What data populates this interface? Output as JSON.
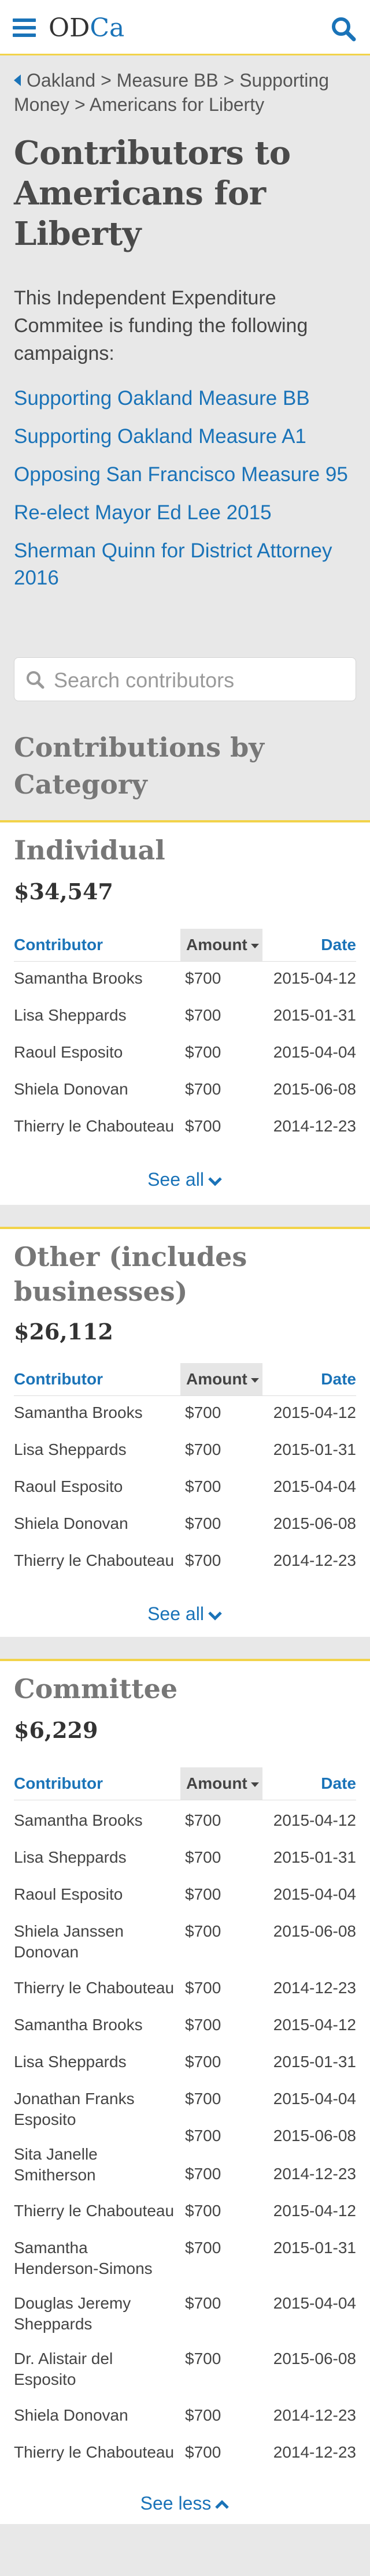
{
  "header": {
    "logo_od": "OD",
    "logo_ca": "Ca"
  },
  "breadcrumb": {
    "items": [
      "Oakland",
      "Measure BB",
      "Supporting Money",
      "Americans for Liberty"
    ],
    "separator": ">"
  },
  "page": {
    "title": "Contributors to Americans for Liberty",
    "intro": "This Independent Expenditure Commitee is funding the following campaigns:"
  },
  "campaigns": [
    "Supporting Oakland Measure BB",
    "Supporting Oakland Measure A1",
    "Opposing San Francisco Measure 95",
    "Re-elect Mayor Ed Lee 2015",
    "Sherman Quinn for District Attorney 2016"
  ],
  "search": {
    "placeholder": "Search contributors",
    "value": ""
  },
  "categories_heading": "Contributions by Category",
  "table_headers": {
    "contributor": "Contributor",
    "amount": "Amount",
    "date": "Date"
  },
  "sections": [
    {
      "title": "Individual",
      "total": "$34,547",
      "rows": [
        {
          "name": "Samantha Brooks",
          "amount": "$700",
          "date": "2015-04-12"
        },
        {
          "name": "Lisa Sheppards",
          "amount": "$700",
          "date": "2015-01-31"
        },
        {
          "name": "Raoul Esposito",
          "amount": "$700",
          "date": "2015-04-04"
        },
        {
          "name": "Shiela Donovan",
          "amount": "$700",
          "date": "2015-06-08"
        },
        {
          "name": "Thierry le Chabouteau",
          "amount": "$700",
          "date": "2014-12-23"
        }
      ],
      "toggle_label": "See all"
    },
    {
      "title": "Other (includes businesses)",
      "total": "$26,112",
      "rows": [
        {
          "name": "Samantha Brooks",
          "amount": "$700",
          "date": "2015-04-12"
        },
        {
          "name": "Lisa Sheppards",
          "amount": "$700",
          "date": "2015-01-31"
        },
        {
          "name": "Raoul Esposito",
          "amount": "$700",
          "date": "2015-04-04"
        },
        {
          "name": "Shiela Donovan",
          "amount": "$700",
          "date": "2015-06-08"
        },
        {
          "name": "Thierry le Chabouteau",
          "amount": "$700",
          "date": "2014-12-23"
        }
      ],
      "toggle_label": "See all"
    },
    {
      "title": "Committee",
      "total": "$6,229",
      "rows": [
        {
          "name": "Samantha Brooks",
          "amount": "$700",
          "date": "2015-04-12"
        },
        {
          "name": "Lisa Sheppards",
          "amount": "$700",
          "date": "2015-01-31"
        },
        {
          "name": "Raoul Esposito",
          "amount": "$700",
          "date": "2015-04-04"
        },
        {
          "name": "Shiela Janssen Donovan",
          "amount": "$700",
          "date": "2015-06-08"
        },
        {
          "name": "Thierry le Chabouteau",
          "amount": "$700",
          "date": "2014-12-23"
        },
        {
          "name": "Samantha Brooks",
          "amount": "$700",
          "date": "2015-04-12"
        },
        {
          "name": "Lisa Sheppards",
          "amount": "$700",
          "date": "2015-01-31"
        },
        {
          "name": "Jonathan Franks Esposito",
          "amount": "$700",
          "date": "2015-04-04"
        },
        {
          "name": "",
          "amount": "$700",
          "date": "2015-06-08"
        },
        {
          "name": "Sita Janelle Smitherson",
          "amount": "$700",
          "date": "2014-12-23"
        },
        {
          "name": "Thierry le Chabouteau",
          "amount": "$700",
          "date": "2015-04-12"
        },
        {
          "name": "Samantha Henderson-Simons",
          "amount": "$700",
          "date": "2015-01-31"
        },
        {
          "name": "Douglas Jeremy Sheppards",
          "amount": "$700",
          "date": "2015-04-04"
        },
        {
          "name": "Dr. Alistair del Esposito",
          "amount": "$700",
          "date": "2015-06-08"
        },
        {
          "name": "Shiela Donovan",
          "amount": "$700",
          "date": "2014-12-23"
        },
        {
          "name": "Thierry le Chabouteau",
          "amount": "$700",
          "date": "2014-12-23"
        }
      ],
      "toggle_label": "See less"
    }
  ],
  "colors": {
    "accent": "#1a73b8",
    "highlight": "#f2d34a"
  }
}
